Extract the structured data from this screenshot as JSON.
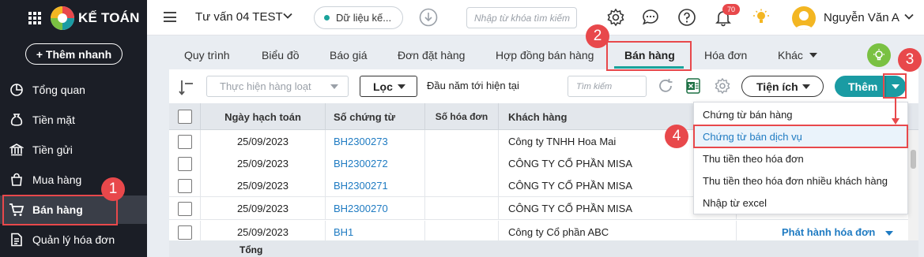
{
  "sidebar": {
    "logo_text": "KẾ TOÁN",
    "quick_add": "+ Thêm nhanh",
    "items": [
      {
        "label": "Tổng quan",
        "icon": "pie-chart-icon"
      },
      {
        "label": "Tiền mặt",
        "icon": "money-bag-icon"
      },
      {
        "label": "Tiền gửi",
        "icon": "bank-icon"
      },
      {
        "label": "Mua hàng",
        "icon": "shopping-bag-icon"
      },
      {
        "label": "Bán hàng",
        "icon": "cart-icon",
        "active": true
      },
      {
        "label": "Quản lý hóa đơn",
        "icon": "invoice-icon"
      }
    ]
  },
  "topbar": {
    "company": "Tư vấn 04 TEST",
    "data_status": "Dữ liệu kế...",
    "search_placeholder": "Nhập từ khóa tìm kiếm",
    "notification_count": "70",
    "user_name": "Nguyễn Văn A"
  },
  "tabs": [
    {
      "label": "Quy trình"
    },
    {
      "label": "Biểu đồ"
    },
    {
      "label": "Báo giá"
    },
    {
      "label": "Đơn đặt hàng"
    },
    {
      "label": "Hợp đồng bán hàng"
    },
    {
      "label": "Bán hàng",
      "active": true
    },
    {
      "label": "Hóa đơn"
    },
    {
      "label": "Khác"
    }
  ],
  "toolbar": {
    "bulk_action": "Thực hiện hàng loạt",
    "filter": "Lọc",
    "period": "Đầu năm tới hiện tại",
    "search_placeholder": "Tìm kiếm",
    "utility": "Tiện ích",
    "add": "Thêm"
  },
  "table": {
    "headers": {
      "date": "Ngày hạch toán",
      "voucher_no": "Số chứng từ",
      "invoice_no": "Số hóa đơn",
      "customer": "Khách hàng"
    },
    "rows": [
      {
        "date": "25/09/2023",
        "voucher_no": "BH2300273",
        "customer": "Công ty TNHH Hoa Mai"
      },
      {
        "date": "25/09/2023",
        "voucher_no": "BH2300272",
        "customer": "CÔNG TY CỔ PHẦN MISA"
      },
      {
        "date": "25/09/2023",
        "voucher_no": "BH2300271",
        "customer": "CÔNG TY CỔ PHẦN MISA"
      },
      {
        "date": "25/09/2023",
        "voucher_no": "BH2300270",
        "customer": "CÔNG TY CỔ PHẦN MISA"
      },
      {
        "date": "25/09/2023",
        "voucher_no": "BH1",
        "customer": "Công ty Cổ phần ABC"
      }
    ],
    "issue_invoice": "Phát hành hóa đơn",
    "total_label": "Tổng"
  },
  "add_menu": [
    {
      "label": "Chứng từ bán hàng"
    },
    {
      "label": "Chứng từ bán dịch vụ",
      "highlighted": true
    },
    {
      "label": "Thu tiền theo hóa đơn"
    },
    {
      "label": "Thu tiền theo hóa đơn nhiều khách hàng"
    },
    {
      "label": "Nhập từ excel"
    }
  ],
  "callouts": [
    "1",
    "2",
    "3",
    "4"
  ],
  "colors": {
    "sidebar_bg": "#1b1e26",
    "accent": "#1a9ba3",
    "callout": "#e8484b",
    "link": "#1f7bc2"
  }
}
